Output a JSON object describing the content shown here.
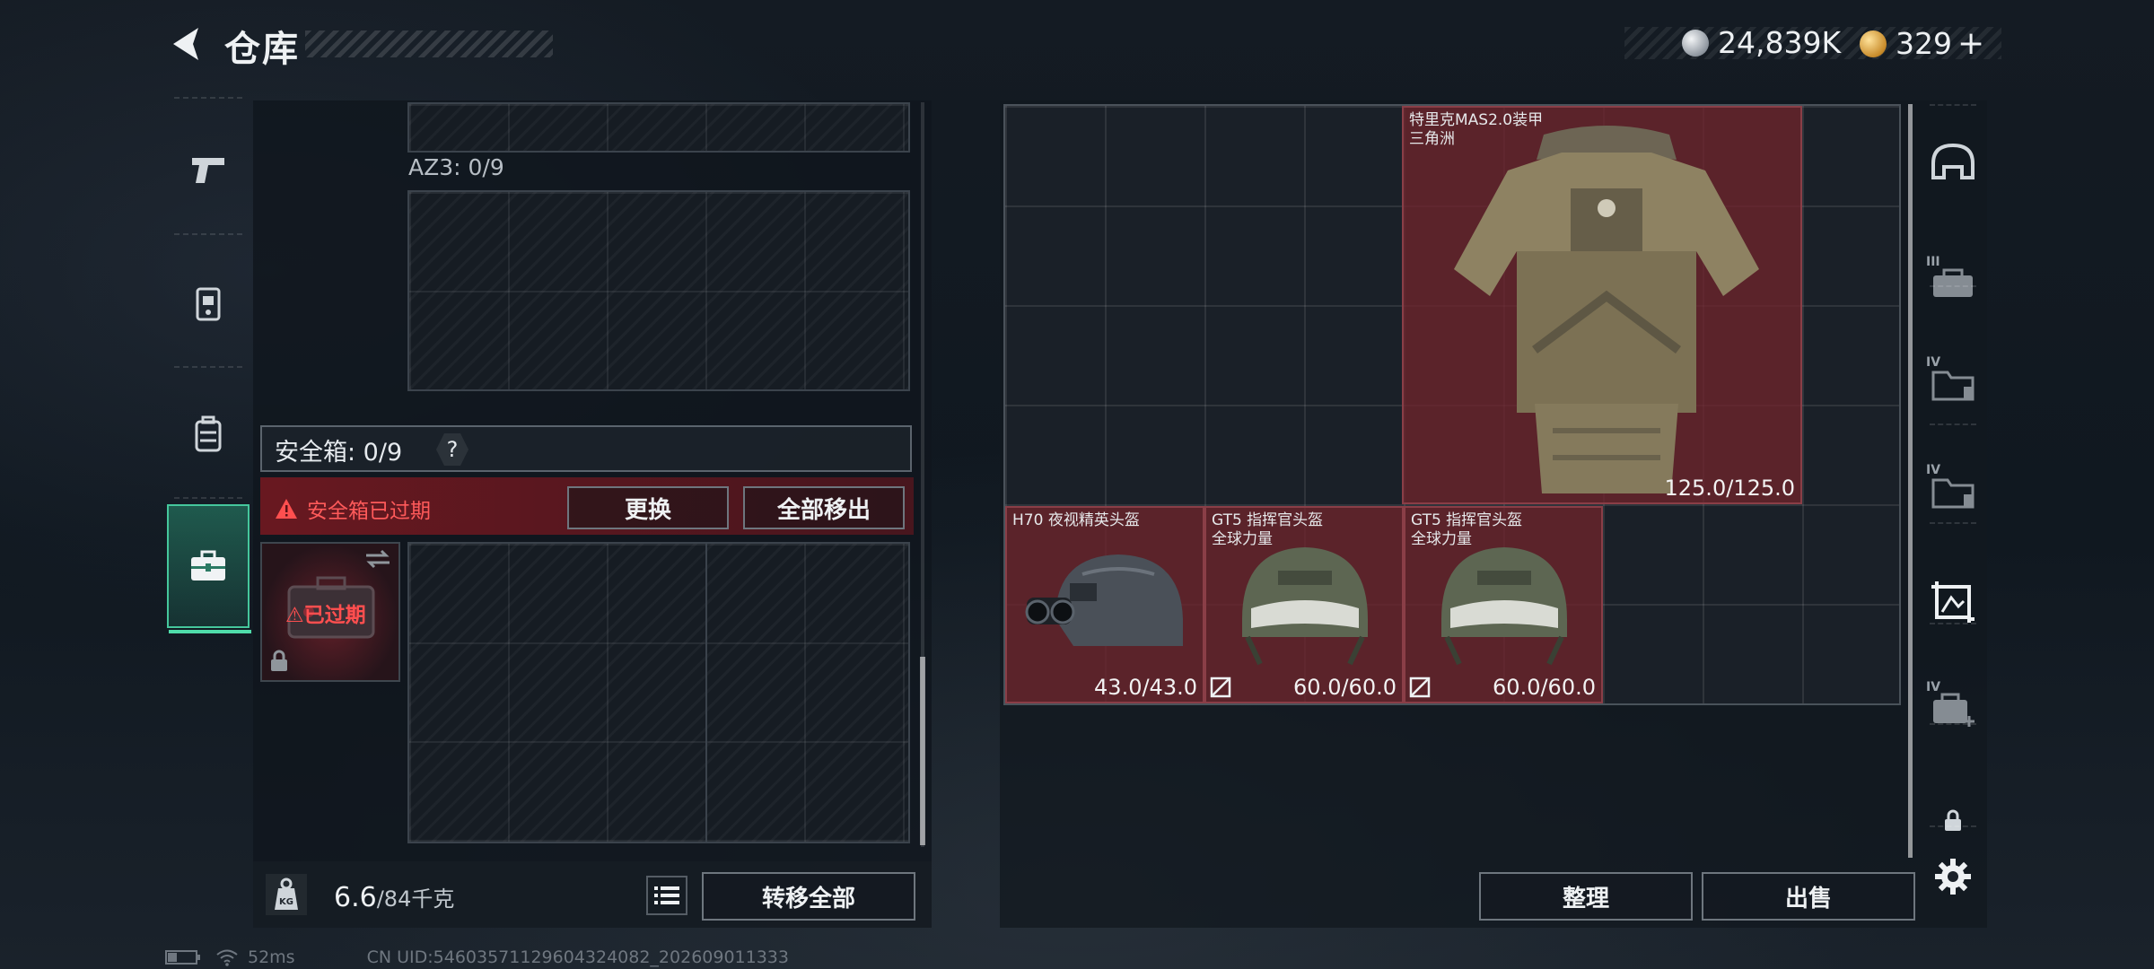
{
  "header": {
    "title": "仓库",
    "currency_silver": "24,839K",
    "currency_gold": "329",
    "gold_add": "+"
  },
  "left_nav": {
    "items": [
      {
        "icon": "pistol-icon"
      },
      {
        "icon": "chest-rig-icon"
      },
      {
        "icon": "backpack-icon"
      },
      {
        "icon": "briefcase-icon",
        "active": true
      }
    ]
  },
  "containers": {
    "az3_label": "AZ3: 0/9",
    "safebox_title": "安全箱: 0/9",
    "safebox_help": "?",
    "expired_warning": "安全箱已过期",
    "replace_button": "更换",
    "remove_all_button": "全部移出",
    "thumb_expired": "已过期"
  },
  "weight": {
    "current": "6.6",
    "max": "/84千克",
    "transfer_all_button": "转移全部"
  },
  "stash": {
    "items": [
      {
        "name_line1": "特里克MAS2.0装甲",
        "name_line2": "三角洲",
        "durability": "125.0/125.0"
      },
      {
        "name_line1": "H70 夜视精英头盔",
        "name_line2": "",
        "durability": "43.0/43.0"
      },
      {
        "name_line1": "GT5 指挥官头盔",
        "name_line2": "全球力量",
        "durability": "60.0/60.0"
      },
      {
        "name_line1": "GT5 指挥官头盔",
        "name_line2": "全球力量",
        "durability": "60.0/60.0"
      }
    ],
    "sort_button": "整理",
    "sell_button": "出售"
  },
  "right_nav": {
    "items": [
      {
        "icon": "helmet-icon",
        "level": ""
      },
      {
        "icon": "rifle-case-icon",
        "level": "III"
      },
      {
        "icon": "folder-case-icon",
        "level": "IV"
      },
      {
        "icon": "folder-case-icon",
        "level": "IV"
      },
      {
        "icon": "crop-frame-icon",
        "level": ""
      },
      {
        "icon": "medkit-case-icon",
        "level": "IV"
      },
      {
        "icon": "lock-icon",
        "level": ""
      },
      {
        "icon": "gear-icon",
        "level": ""
      }
    ]
  },
  "status": {
    "ping": "52ms",
    "uid": "CN UID:546035711296043240​82_202609011333"
  }
}
